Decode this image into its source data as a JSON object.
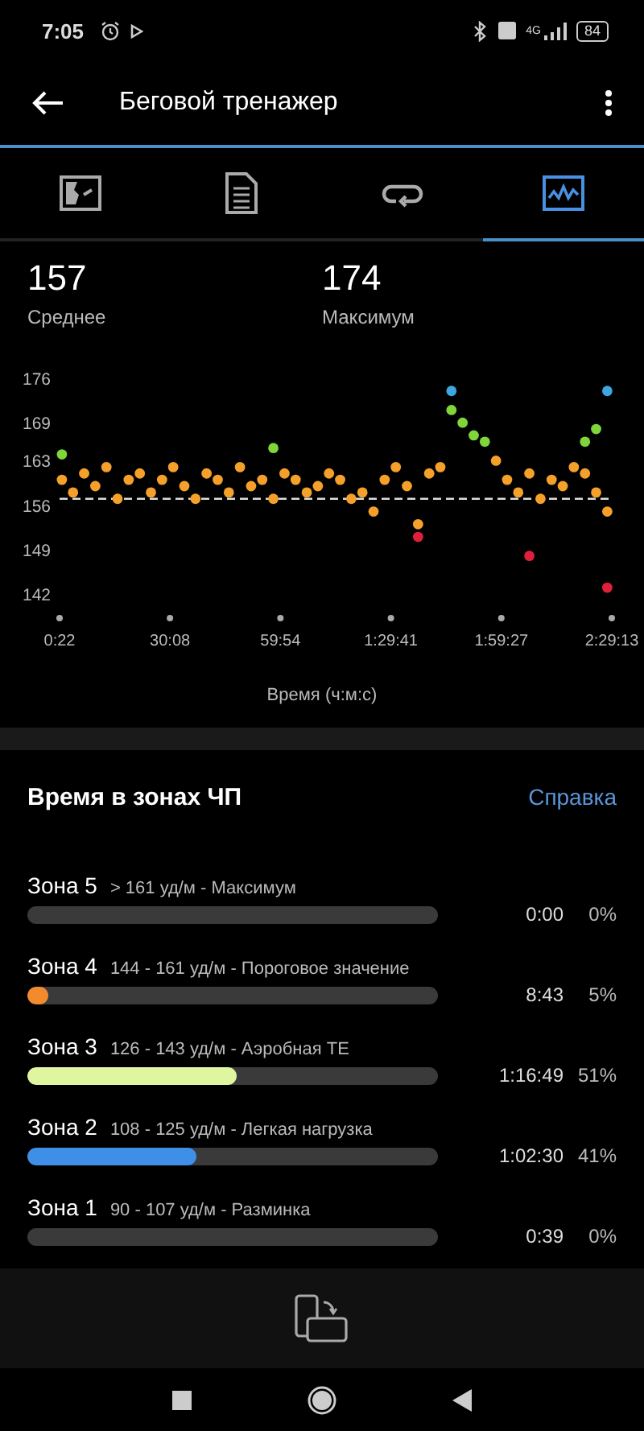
{
  "status_bar": {
    "time": "7:05",
    "network": "4G",
    "battery": "84"
  },
  "app_bar": {
    "title": "Беговой тренажер"
  },
  "tabs": [
    {
      "kind": "map",
      "selected": false
    },
    {
      "kind": "document",
      "selected": false
    },
    {
      "kind": "loop",
      "selected": false
    },
    {
      "kind": "chart",
      "selected": true
    }
  ],
  "stats": [
    {
      "value": "157",
      "label": "Среднее"
    },
    {
      "value": "174",
      "label": "Максимум"
    }
  ],
  "chart_data": {
    "type": "scatter",
    "xlabel": "Время (ч:м:с)",
    "x": [
      1,
      4,
      7,
      10,
      13,
      16,
      19,
      22,
      25,
      28,
      31,
      34,
      37,
      40,
      43,
      46,
      49,
      52,
      55,
      58,
      61,
      64,
      67,
      70,
      73,
      76,
      79,
      82,
      85,
      88,
      91,
      94,
      97,
      100,
      103,
      106,
      109,
      112,
      115,
      118,
      121,
      124,
      127,
      130,
      133,
      136,
      139,
      142,
      145,
      148
    ],
    "series": [
      {
        "color": "#f5a02a",
        "values": [
          160,
          158,
          161,
          159,
          162,
          157,
          160,
          161,
          158,
          160,
          162,
          159,
          157,
          161,
          160,
          158,
          162,
          159,
          160,
          157,
          161,
          160,
          158,
          159,
          161,
          160,
          157,
          158,
          155,
          160,
          162,
          159,
          153,
          161,
          162,
          null,
          null,
          null,
          null,
          163,
          160,
          158,
          161,
          157,
          160,
          159,
          162,
          161,
          158,
          155
        ]
      },
      {
        "color": "#7ed63a",
        "values": [
          164,
          null,
          null,
          null,
          null,
          null,
          null,
          null,
          null,
          null,
          null,
          null,
          null,
          null,
          null,
          null,
          null,
          null,
          null,
          165,
          null,
          null,
          null,
          null,
          null,
          null,
          null,
          null,
          null,
          null,
          null,
          null,
          null,
          null,
          null,
          171,
          169,
          167,
          166,
          null,
          null,
          null,
          null,
          null,
          null,
          null,
          null,
          166,
          168,
          null
        ]
      },
      {
        "color": "#3ea6e0",
        "values": [
          null,
          null,
          null,
          null,
          null,
          null,
          null,
          null,
          null,
          null,
          null,
          null,
          null,
          null,
          null,
          null,
          null,
          null,
          null,
          null,
          null,
          null,
          null,
          null,
          null,
          null,
          null,
          null,
          null,
          null,
          null,
          null,
          null,
          null,
          null,
          174,
          null,
          null,
          null,
          null,
          null,
          null,
          null,
          null,
          null,
          null,
          null,
          null,
          null,
          174
        ]
      },
      {
        "color": "#e0203a",
        "values": [
          null,
          null,
          null,
          null,
          null,
          null,
          null,
          null,
          null,
          null,
          null,
          null,
          null,
          null,
          null,
          null,
          null,
          null,
          null,
          null,
          null,
          null,
          null,
          null,
          null,
          null,
          null,
          null,
          null,
          null,
          null,
          null,
          151,
          null,
          null,
          null,
          null,
          null,
          null,
          null,
          null,
          null,
          148,
          null,
          null,
          null,
          null,
          null,
          null,
          143
        ]
      }
    ],
    "xlim": [
      0.37,
      149.22
    ],
    "ylim": [
      142,
      176
    ],
    "xticks": [
      {
        "value": 0.37,
        "label": "0:22"
      },
      {
        "value": 30.13,
        "label": "30:08"
      },
      {
        "value": 59.9,
        "label": "59:54"
      },
      {
        "value": 89.68,
        "label": "1:29:41"
      },
      {
        "value": 119.45,
        "label": "1:59:27"
      },
      {
        "value": 149.22,
        "label": "2:29:13"
      }
    ],
    "yticks": [
      176,
      169,
      163,
      156,
      149,
      142
    ],
    "ref_lines": [
      {
        "axis": "y",
        "value": 157
      }
    ]
  },
  "zones": {
    "title": "Время в зонах ЧП",
    "help_link": "Справка",
    "items": [
      {
        "name": "Зона 5",
        "range": "> 161 уд/м - Максимум",
        "time": "0:00",
        "percent": "0%"
      },
      {
        "name": "Зона 4",
        "range": "144 - 161 уд/м - Пороговое значение",
        "time": "8:43",
        "percent": "5%",
        "level": 0.05,
        "color": "#f28a2e"
      },
      {
        "name": "Зона 3",
        "range": "126 - 143 уд/м - Аэробная ТЕ",
        "time": "1:16:49",
        "percent": "51%",
        "level": 0.51,
        "color": "#dff5a0"
      },
      {
        "name": "Зона 2",
        "range": "108 - 125 уд/м - Легкая нагрузка",
        "time": "1:02:30",
        "percent": "41%",
        "level": 0.41,
        "color": "#3f8ee8"
      },
      {
        "name": "Зона 1",
        "range": "90 - 107 уд/м - Разминка",
        "time": "0:39",
        "percent": "0%"
      }
    ]
  }
}
